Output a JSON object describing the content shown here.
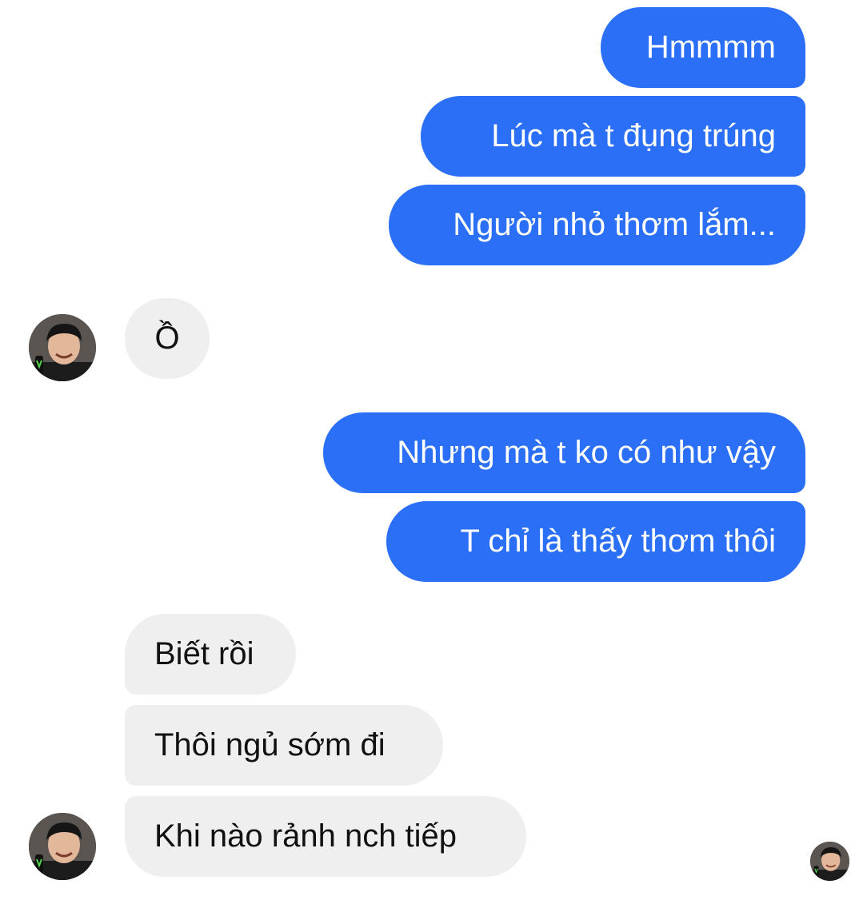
{
  "messages": [
    {
      "direction": "outgoing",
      "text": "Hmmmm"
    },
    {
      "direction": "outgoing",
      "text": "Lúc mà t đụng trúng"
    },
    {
      "direction": "outgoing",
      "text": "Người nhỏ thơm lắm..."
    },
    {
      "direction": "incoming",
      "text": "Ồ"
    },
    {
      "direction": "outgoing",
      "text": "Nhưng mà t ko có như vậy"
    },
    {
      "direction": "outgoing",
      "text": "T chỉ là thấy thơm thôi"
    },
    {
      "direction": "incoming",
      "text": "Biết rồi"
    },
    {
      "direction": "incoming",
      "text": "Thôi ngủ sớm đi"
    },
    {
      "direction": "incoming",
      "text": "Khi nào rảnh nch tiếp"
    }
  ],
  "colors": {
    "outgoing_bubble": "#2a6ff6",
    "incoming_bubble": "#efefef",
    "background": "#ffffff"
  },
  "icons": {
    "contact_avatar": "contact-avatar-photo",
    "seen_indicator": "seen-avatar-photo"
  }
}
